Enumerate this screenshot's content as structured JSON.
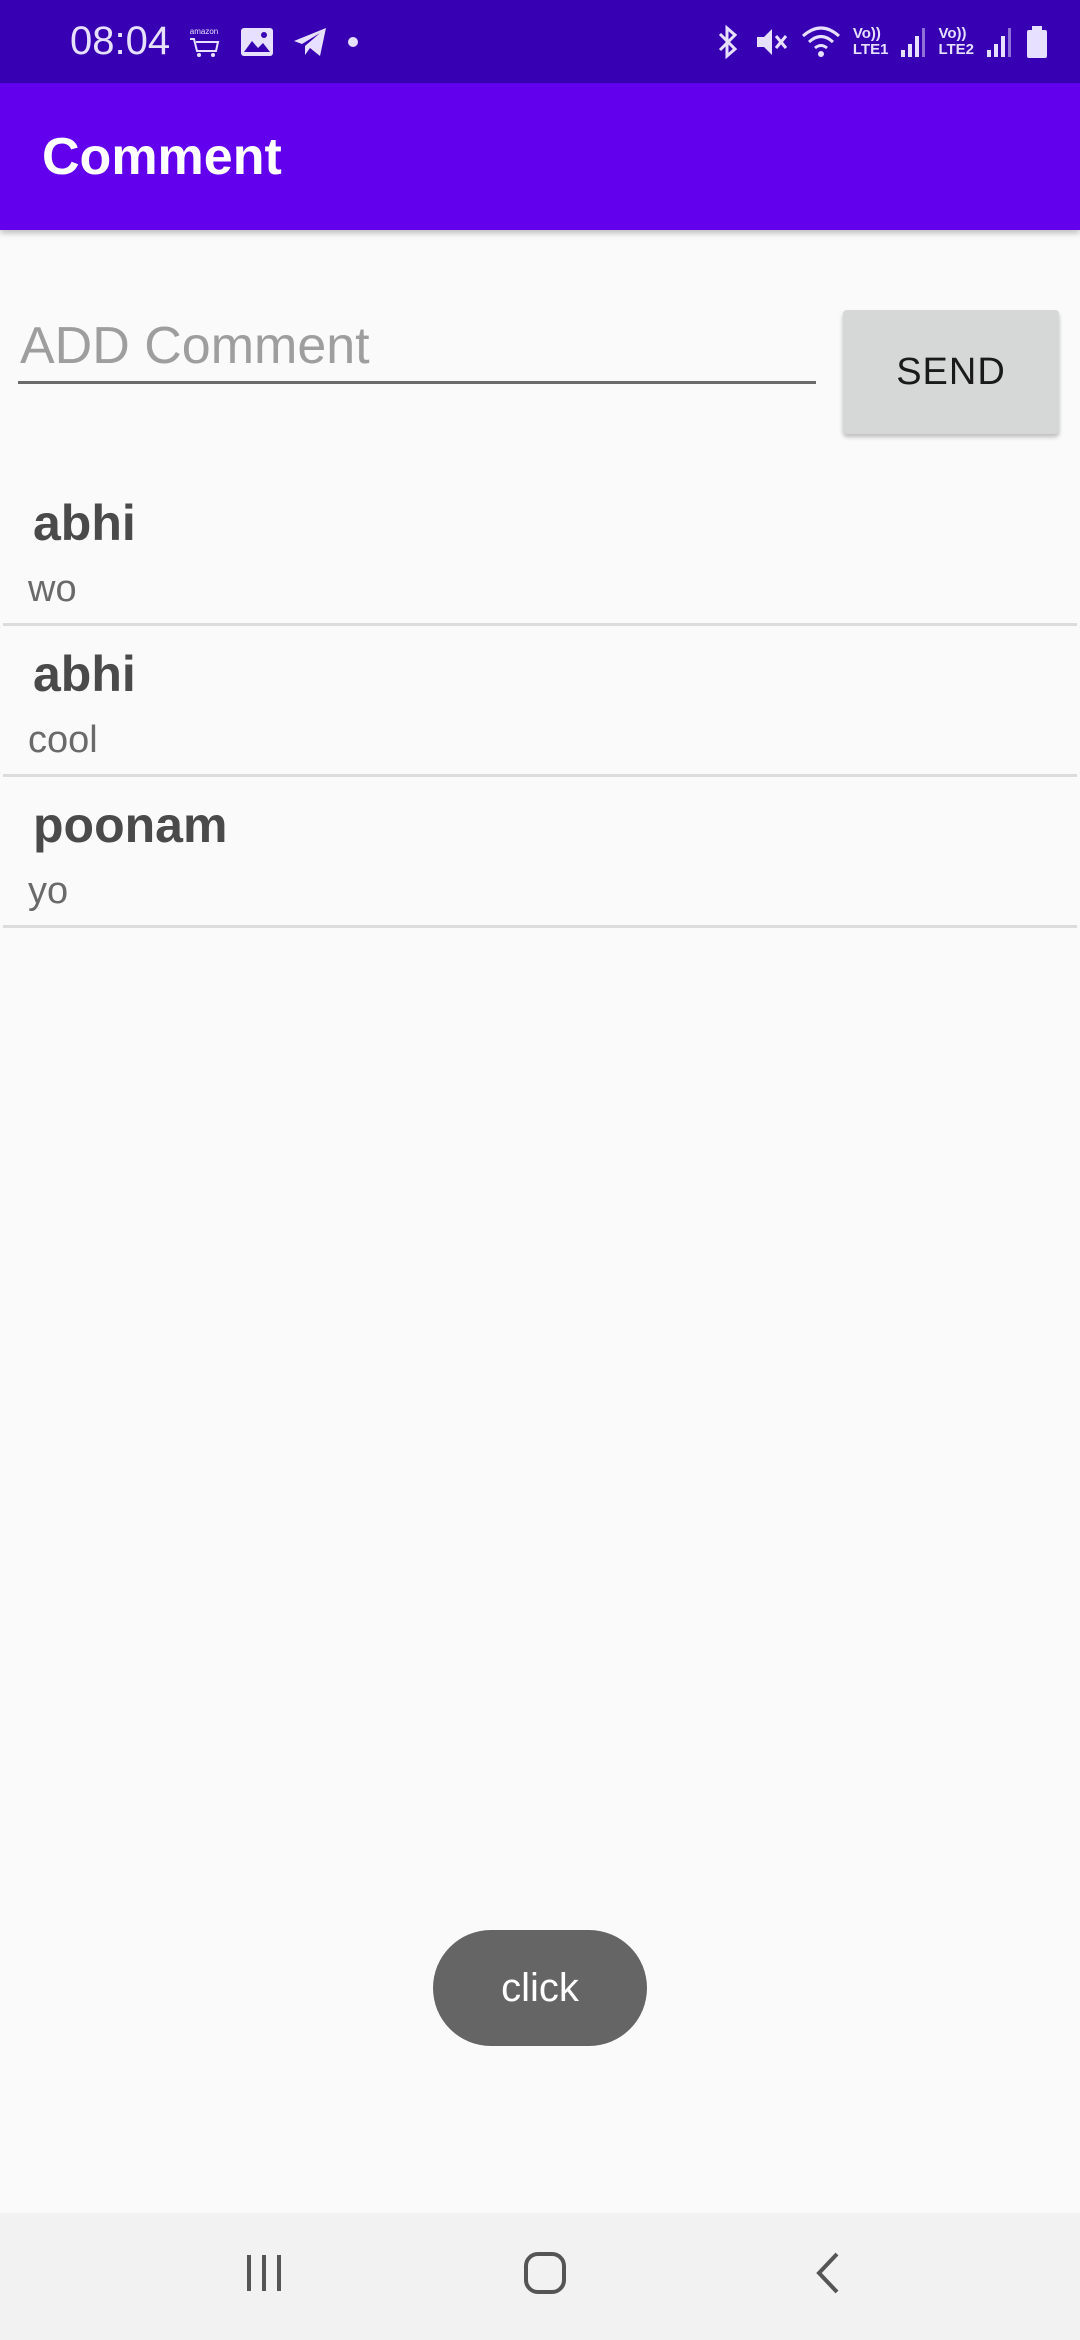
{
  "status_bar": {
    "time": "08:04",
    "left_icons": [
      "amazon-icon",
      "image-icon",
      "telegram-icon",
      "dot-icon"
    ],
    "right_icons": [
      "bluetooth-icon",
      "mute-icon",
      "wifi-icon",
      "signal-icon",
      "signal-icon",
      "battery-icon"
    ],
    "sim1_label_top": "Vo))",
    "sim1_label_bottom": "LTE1",
    "sim2_label_top": "Vo))",
    "sim2_label_bottom": "LTE2",
    "amazon_text": "amazon"
  },
  "app_bar": {
    "title": "Comment"
  },
  "composer": {
    "placeholder": "ADD Comment",
    "value": "",
    "send_label": "SEND"
  },
  "comments": [
    {
      "author": "abhi",
      "text": "wo"
    },
    {
      "author": "abhi",
      "text": "cool"
    },
    {
      "author": "poonam",
      "text": "yo"
    }
  ],
  "toast": {
    "text": "click"
  },
  "nav_bar": {
    "buttons": [
      "recent-apps-icon",
      "home-icon",
      "back-icon"
    ]
  },
  "colors": {
    "status_bar": "#3700b3",
    "app_bar": "#6200ee",
    "background": "#fafafa",
    "send_button": "#d6d7d7",
    "toast": "#656565"
  }
}
